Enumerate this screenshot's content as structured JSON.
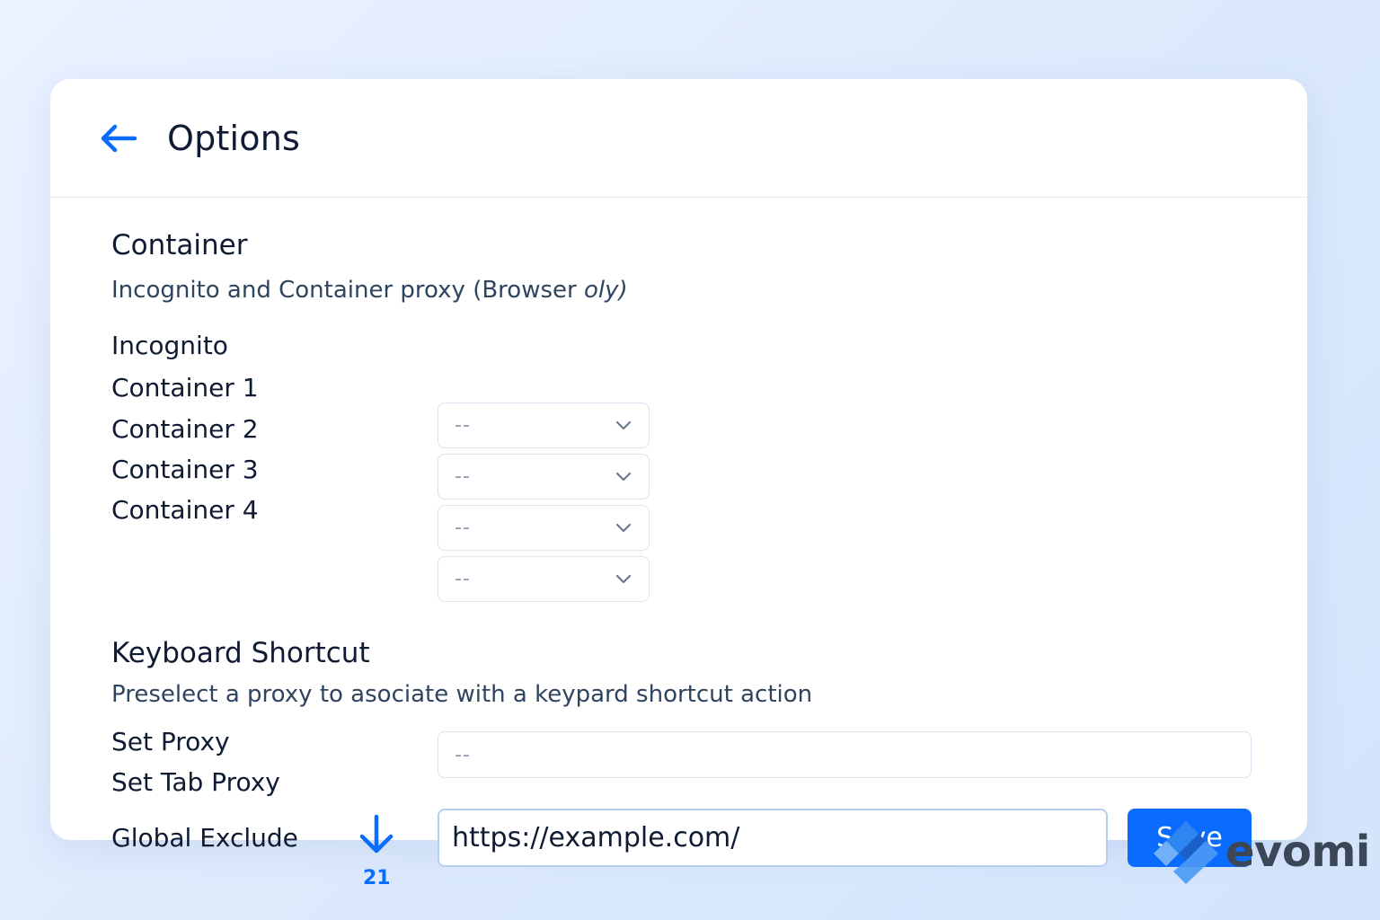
{
  "header": {
    "title": "Options"
  },
  "container": {
    "title": "Container",
    "description_main": "Incognito and Container proxy (Browser ",
    "description_italic": "oly)",
    "rows": [
      {
        "label": "Incognito",
        "value": "--"
      },
      {
        "label": "Container 1",
        "value": "--"
      },
      {
        "label": "Container 2",
        "value": "--"
      },
      {
        "label": "Container 3",
        "value": "--"
      },
      {
        "label": "Container 4",
        "value": "--"
      }
    ]
  },
  "shortcut": {
    "title": "Keyboard Shortcut",
    "description": "Preselect a proxy to asociate with a keypard shortcut action",
    "set_proxy_label": "Set Proxy",
    "set_tab_proxy_label": "Set Tab Proxy",
    "proxy_value": "--"
  },
  "exclude": {
    "label": "Global Exclude",
    "badge": "21",
    "url_value": "https://example.com/",
    "save_label": "Save"
  },
  "brand": {
    "name": "evomi"
  },
  "colors": {
    "accent": "#0a6cff",
    "text": "#0f1b33",
    "muted": "#8b99ad"
  }
}
